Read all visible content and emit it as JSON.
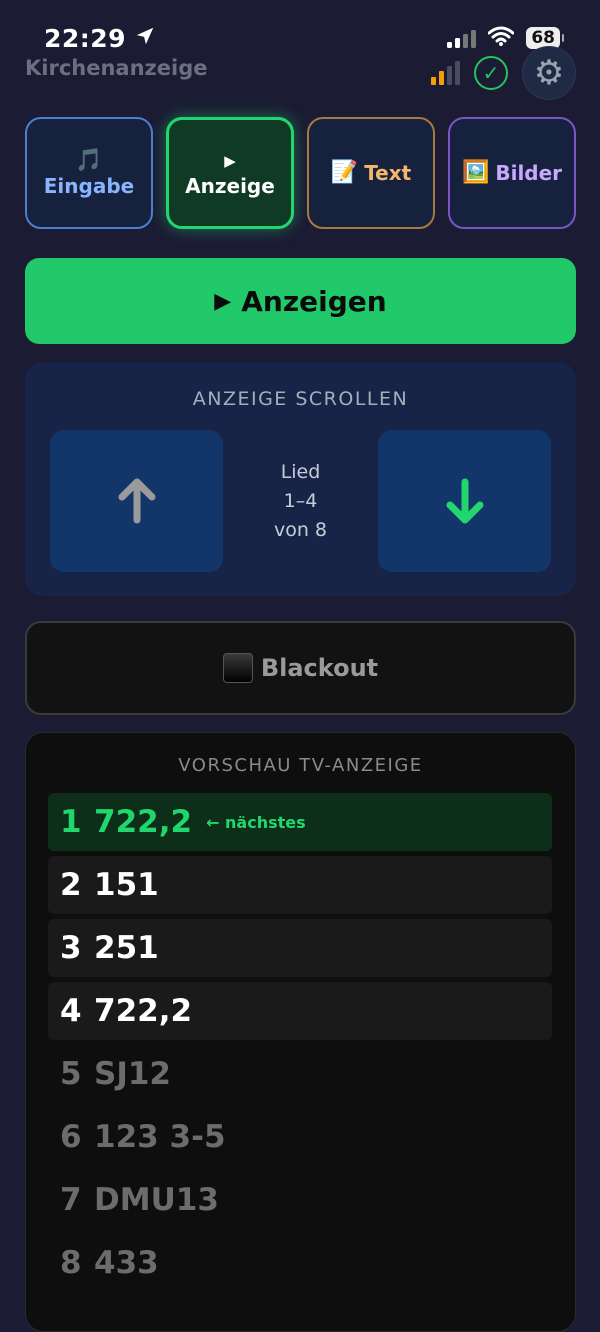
{
  "status_bar": {
    "time": "22:29",
    "battery": "68"
  },
  "app": {
    "title": "Kirchenanzeige",
    "settings_icon": "⚙"
  },
  "tabs": [
    {
      "icon": "🎵",
      "label": "Eingabe"
    },
    {
      "icon": "▶",
      "label": "Anzeige"
    },
    {
      "icon": "📝",
      "label": "Text"
    },
    {
      "icon": "🖼️",
      "label": "Bilder"
    }
  ],
  "primary_action": {
    "icon": "▶",
    "label": "Anzeigen"
  },
  "scroll_panel": {
    "title": "ANZEIGE SCROLLEN",
    "info_line1": "Lied",
    "info_line2": "1–4",
    "info_line3": "von 8"
  },
  "blackout": {
    "label": "Blackout"
  },
  "preview": {
    "title": "VORSCHAU TV-ANZEIGE",
    "next_tag": "← nächstes",
    "rows": [
      {
        "num": "1",
        "song": "722,2"
      },
      {
        "num": "2",
        "song": "151"
      },
      {
        "num": "3",
        "song": "251"
      },
      {
        "num": "4",
        "song": "722,2"
      },
      {
        "num": "5",
        "song": "SJ12"
      },
      {
        "num": "6",
        "song": "123 3-5"
      },
      {
        "num": "7",
        "song": "DMU13"
      },
      {
        "num": "8",
        "song": "433"
      }
    ]
  },
  "colors": {
    "background": "#1b1b33",
    "accent_green": "#22c96a",
    "eingabe_blue": "#4a7fd0",
    "text_orange": "#a57a3e",
    "bilder_purple": "#7a55c6"
  }
}
